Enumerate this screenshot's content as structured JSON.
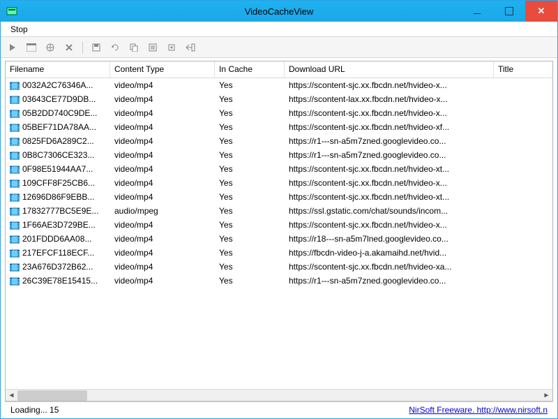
{
  "window": {
    "title": "VideoCacheView"
  },
  "menu": {
    "stop": "Stop"
  },
  "columns": {
    "filename": "Filename",
    "content_type": "Content Type",
    "in_cache": "In Cache",
    "download_url": "Download URL",
    "title": "Title"
  },
  "rows": [
    {
      "filename": "0032A2C76346A...",
      "content_type": "video/mp4",
      "in_cache": "Yes",
      "url": "https://scontent-sjc.xx.fbcdn.net/hvideo-x...",
      "title": ""
    },
    {
      "filename": "03643CE77D9DB...",
      "content_type": "video/mp4",
      "in_cache": "Yes",
      "url": "https://scontent-lax.xx.fbcdn.net/hvideo-x...",
      "title": ""
    },
    {
      "filename": "05B2DD740C9DE...",
      "content_type": "video/mp4",
      "in_cache": "Yes",
      "url": "https://scontent-sjc.xx.fbcdn.net/hvideo-x...",
      "title": ""
    },
    {
      "filename": "05BEF71DA78AA...",
      "content_type": "video/mp4",
      "in_cache": "Yes",
      "url": "https://scontent-sjc.xx.fbcdn.net/hvideo-xf...",
      "title": ""
    },
    {
      "filename": "0825FD6A289C2...",
      "content_type": "video/mp4",
      "in_cache": "Yes",
      "url": "https://r1---sn-a5m7zned.googlevideo.co...",
      "title": ""
    },
    {
      "filename": "0B8C7306CE323...",
      "content_type": "video/mp4",
      "in_cache": "Yes",
      "url": "https://r1---sn-a5m7zned.googlevideo.co...",
      "title": ""
    },
    {
      "filename": "0F98E51944AA7...",
      "content_type": "video/mp4",
      "in_cache": "Yes",
      "url": "https://scontent-sjc.xx.fbcdn.net/hvideo-xt...",
      "title": ""
    },
    {
      "filename": "109CFF8F25CB6...",
      "content_type": "video/mp4",
      "in_cache": "Yes",
      "url": "https://scontent-sjc.xx.fbcdn.net/hvideo-x...",
      "title": ""
    },
    {
      "filename": "12696D86F9EBB...",
      "content_type": "video/mp4",
      "in_cache": "Yes",
      "url": "https://scontent-sjc.xx.fbcdn.net/hvideo-xt...",
      "title": ""
    },
    {
      "filename": "17832777BC5E9E...",
      "content_type": "audio/mpeg",
      "in_cache": "Yes",
      "url": "https://ssl.gstatic.com/chat/sounds/incom...",
      "title": ""
    },
    {
      "filename": "1F66AE3D729BE...",
      "content_type": "video/mp4",
      "in_cache": "Yes",
      "url": "https://scontent-sjc.xx.fbcdn.net/hvideo-x...",
      "title": ""
    },
    {
      "filename": "201FDDD6AA08...",
      "content_type": "video/mp4",
      "in_cache": "Yes",
      "url": "https://r18---sn-a5m7lned.googlevideo.co...",
      "title": ""
    },
    {
      "filename": "217EFCF118ECF...",
      "content_type": "video/mp4",
      "in_cache": "Yes",
      "url": "https://fbcdn-video-j-a.akamaihd.net/hvid...",
      "title": ""
    },
    {
      "filename": "23A676D372B62...",
      "content_type": "video/mp4",
      "in_cache": "Yes",
      "url": "https://scontent-sjc.xx.fbcdn.net/hvideo-xa...",
      "title": ""
    },
    {
      "filename": "26C39E78E15415...",
      "content_type": "video/mp4",
      "in_cache": "Yes",
      "url": "https://r1---sn-a5m7zned.googlevideo.co...",
      "title": ""
    }
  ],
  "status": {
    "left": "Loading... 15",
    "right": "NirSoft Freeware. http://www.nirsoft.n"
  },
  "toolbar_icons": [
    "play",
    "browser",
    "globe",
    "delete",
    "save",
    "refresh",
    "copy",
    "properties",
    "options",
    "exit"
  ]
}
